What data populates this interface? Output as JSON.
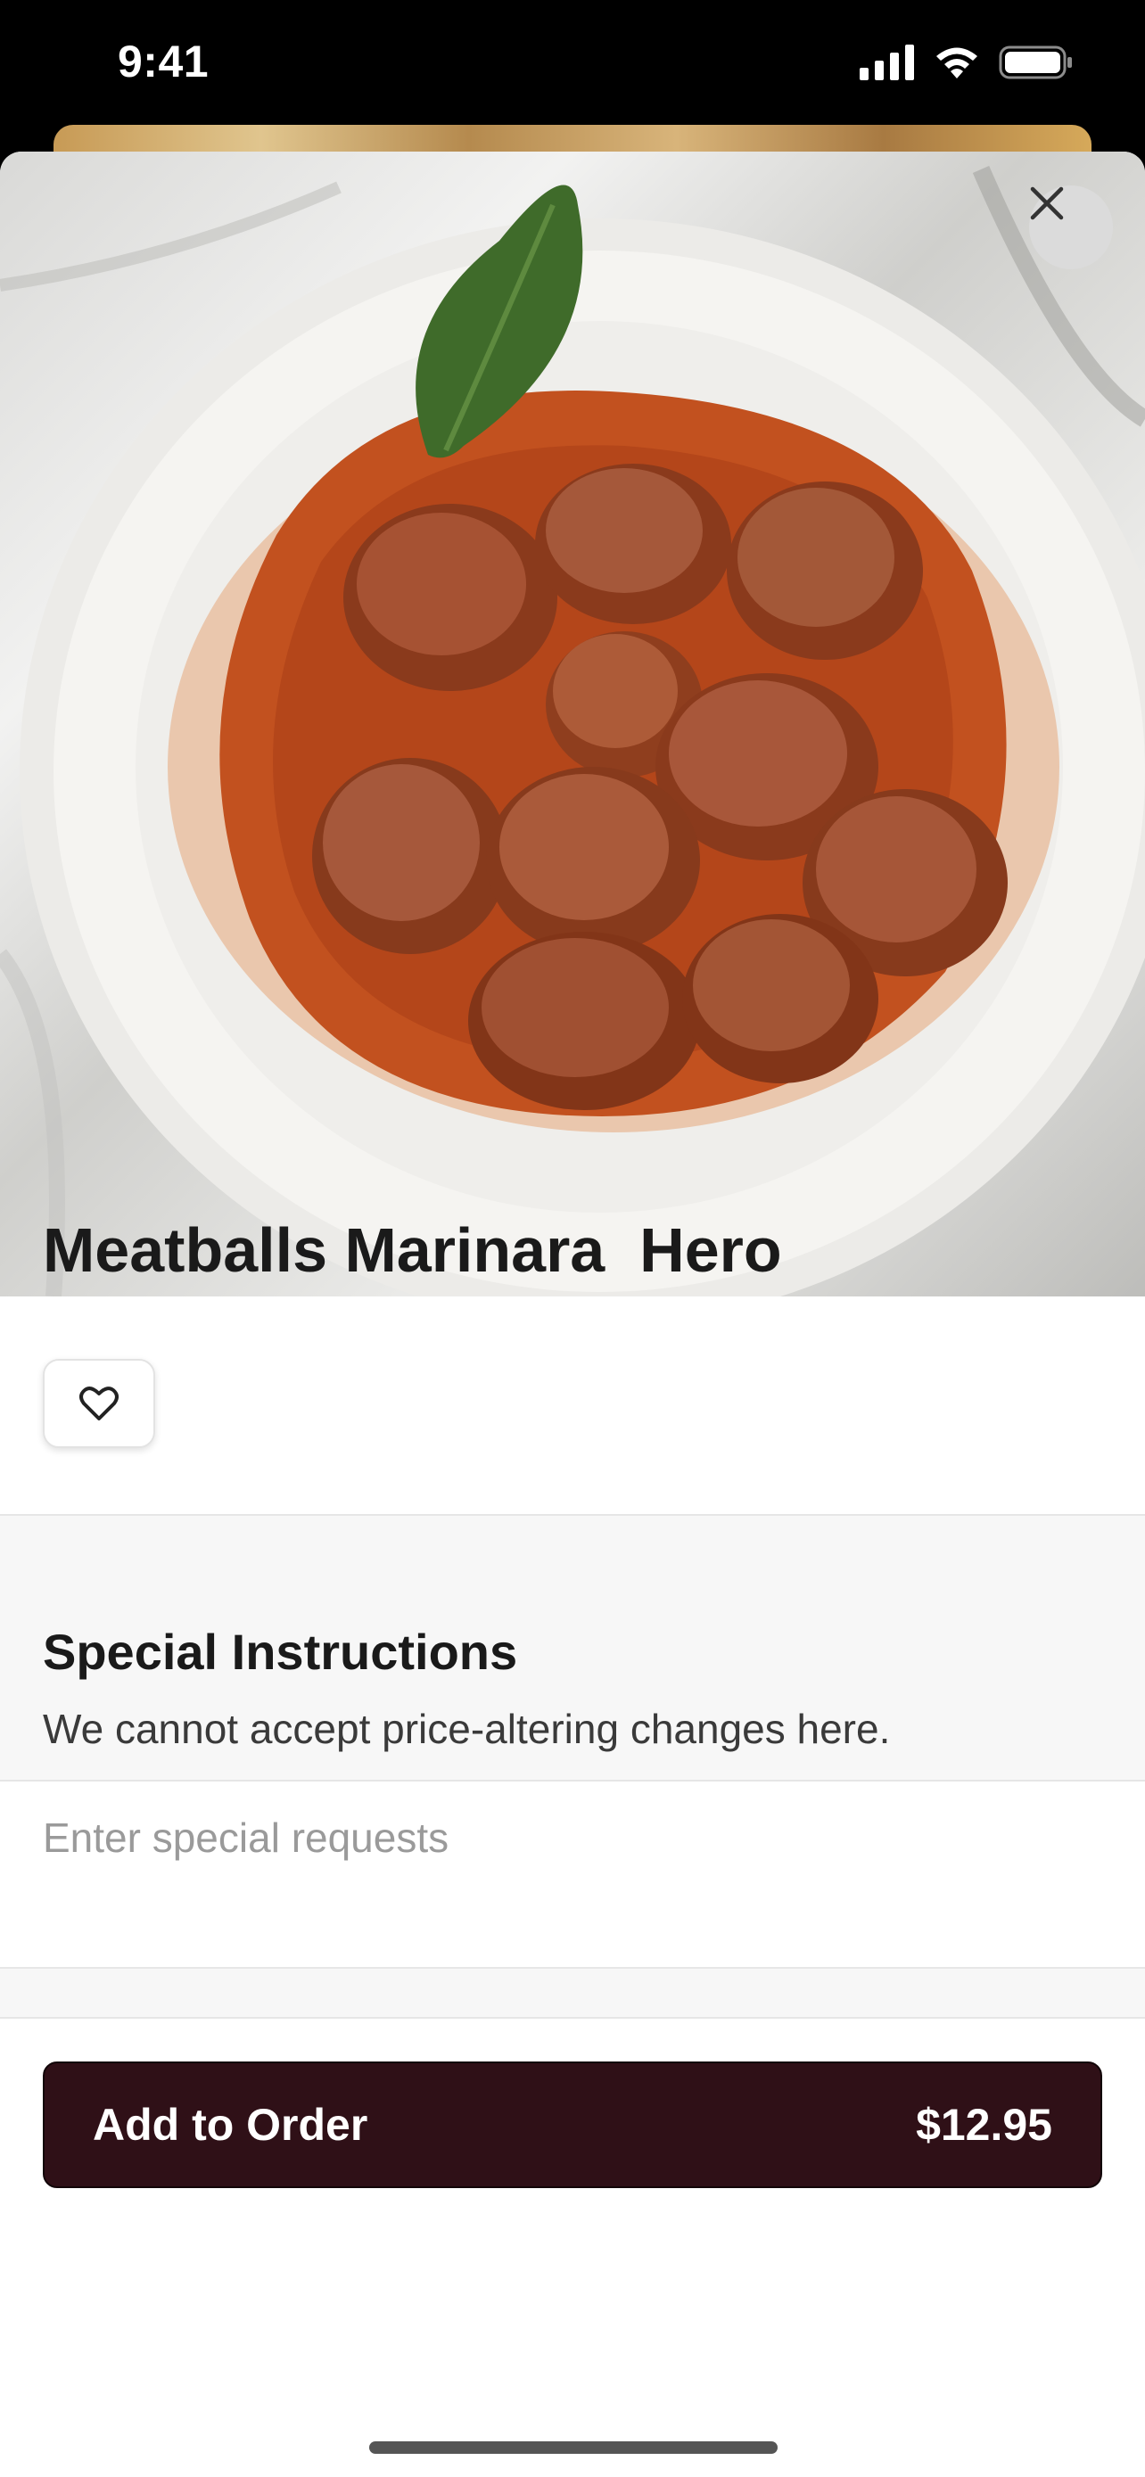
{
  "status_bar": {
    "time": "9:41",
    "icons": [
      "cellular-signal-icon",
      "wifi-icon",
      "battery-icon"
    ]
  },
  "sheet": {
    "close_icon": "close-icon",
    "hero_image": "meatballs-marinara-photo"
  },
  "item": {
    "title": "Meatballs Marinara  Hero",
    "favorite_icon": "heart-icon"
  },
  "instructions": {
    "title": "Special Instructions",
    "subtitle": "We cannot accept price-altering changes here.",
    "input_placeholder": "Enter special requests",
    "input_value": ""
  },
  "footer": {
    "button_label": "Add to Order",
    "price": "$12.95"
  },
  "colors": {
    "button_bg": "#2f1017",
    "section_bg": "#f7f7f7",
    "text": "#1a1a1a"
  }
}
